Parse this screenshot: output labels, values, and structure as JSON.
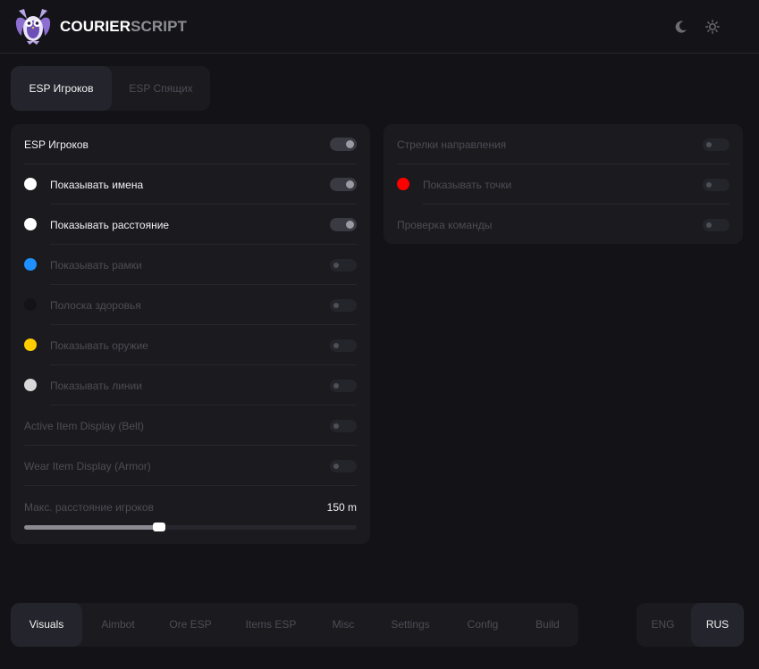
{
  "header": {
    "brand_part1": "COURIER",
    "brand_part2": "SCRIPT",
    "logo_icon": "owl-logo-icon",
    "theme_icons": [
      "moon-icon",
      "sun-icon"
    ]
  },
  "subtabs": [
    {
      "label": "ESP Игроков",
      "active": true
    },
    {
      "label": "ESP Спящих",
      "active": false
    }
  ],
  "left_panel": {
    "rows": [
      {
        "label": "ESP Игроков",
        "enabled": true,
        "dot": null
      },
      {
        "label": "Показывать имена",
        "enabled": true,
        "dot": "#ffffff"
      },
      {
        "label": "Показывать расстояние",
        "enabled": true,
        "dot": "#ffffff"
      },
      {
        "label": "Показывать рамки",
        "enabled": false,
        "dot": "#1e90ff"
      },
      {
        "label": "Полоска здоровья",
        "enabled": false,
        "dot": "#141418"
      },
      {
        "label": "Показывать оружие",
        "enabled": false,
        "dot": "#ffcc00"
      },
      {
        "label": "Показывать линии",
        "enabled": false,
        "dot": "#d8d8d8"
      },
      {
        "label": "Active Item Display (Belt)",
        "enabled": false,
        "dot": null
      },
      {
        "label": "Wear Item Display (Armor)",
        "enabled": false,
        "dot": null
      }
    ],
    "slider": {
      "label": "Макс. расстояние игроков",
      "value_text": "150 m",
      "fraction": 0.405
    }
  },
  "right_panel": {
    "rows": [
      {
        "label": "Стрелки направления",
        "enabled": false,
        "dot": null
      },
      {
        "label": "Показывать точки",
        "enabled": false,
        "dot": "#ff0000"
      },
      {
        "label": "Проверка команды",
        "enabled": false,
        "dot": null
      }
    ]
  },
  "nav": {
    "items": [
      {
        "label": "Visuals",
        "active": true
      },
      {
        "label": "Aimbot",
        "active": false
      },
      {
        "label": "Ore ESP",
        "active": false
      },
      {
        "label": "Items ESP",
        "active": false
      },
      {
        "label": "Misc",
        "active": false
      },
      {
        "label": "Settings",
        "active": false
      },
      {
        "label": "Config",
        "active": false
      },
      {
        "label": "Build",
        "active": false
      }
    ]
  },
  "lang": {
    "items": [
      {
        "label": "ENG",
        "active": false
      },
      {
        "label": "RUS",
        "active": true
      }
    ]
  },
  "colors": {
    "background": "#131317",
    "panel": "#1a1a1f",
    "active_tab": "#24242c",
    "text_active": "#f2f2f4",
    "text_inactive": "#4d4d55"
  }
}
